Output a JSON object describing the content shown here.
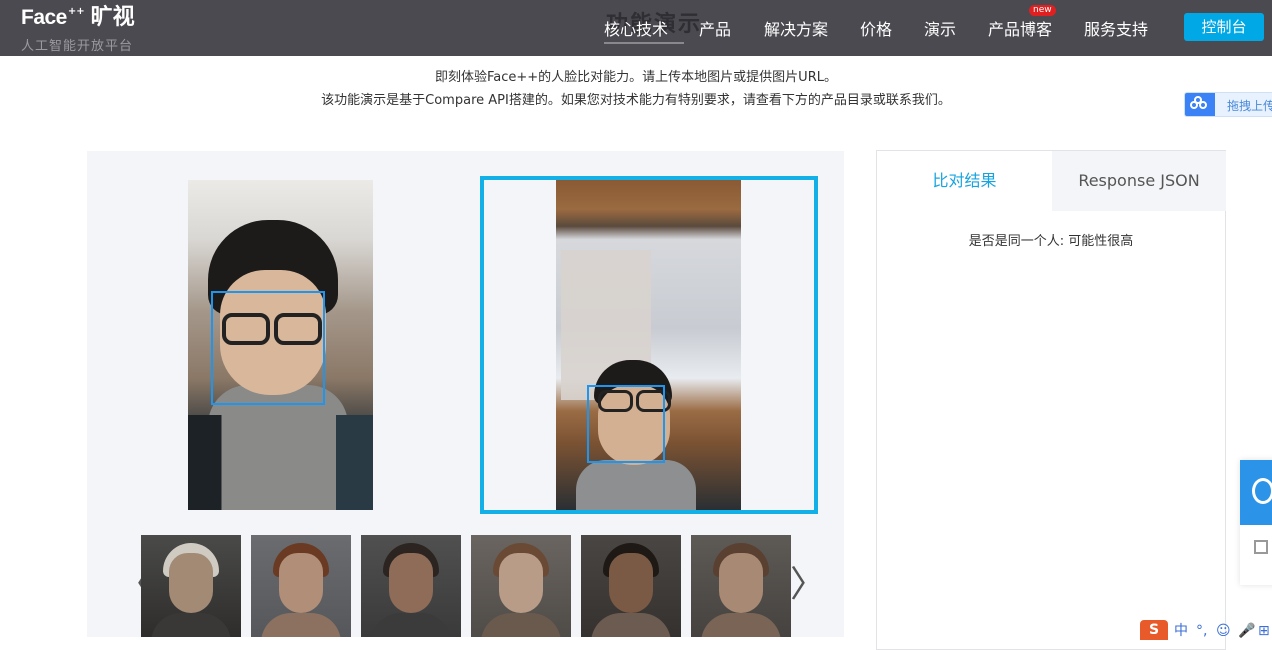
{
  "header": {
    "logo_brand": "Face",
    "logo_plus": "++",
    "logo_cn": "旷视",
    "logo_subtitle": "人工智能开放平台",
    "page_title": "功能演示",
    "nav": [
      {
        "label": "核心技术"
      },
      {
        "label": "产品"
      },
      {
        "label": "解决方案"
      },
      {
        "label": "价格"
      },
      {
        "label": "演示"
      },
      {
        "label": "产品博客"
      },
      {
        "label": "服务支持"
      }
    ],
    "badge_new": "new",
    "console_label": "控制台"
  },
  "intro": {
    "line1": "即刻体验Face++的人脸比对能力。请上传本地图片或提供图片URL。",
    "line2": "该功能演示是基于Compare API搭建的。如果您对技术能力有特别要求，请查看下方的产品目录或联系我们。"
  },
  "upload_widget": {
    "label": "拖拽上传"
  },
  "demo": {
    "prev_arrow": "〈",
    "next_arrow": "〉",
    "thumbnails": [
      {
        "name": "elderly-man-glasses"
      },
      {
        "name": "woman-auburn-hair"
      },
      {
        "name": "man-glasses-beard"
      },
      {
        "name": "woman-smiling"
      },
      {
        "name": "woman-curly-hair-laughing"
      },
      {
        "name": "woman-hand-on-face"
      }
    ]
  },
  "result": {
    "tabs": [
      {
        "label": "比对结果"
      },
      {
        "label": "Response JSON"
      }
    ],
    "text": "是否是同一个人: 可能性很高"
  },
  "ime": {
    "s_logo": "S",
    "items": [
      "中",
      "°,",
      "☺",
      "🎤",
      "⊞"
    ]
  },
  "colors": {
    "accent": "#13b0e8",
    "face_box": "#1e96ef",
    "header_bg": "#4a4a50",
    "console_btn": "#00a8e6",
    "new_badge": "#e02020"
  }
}
